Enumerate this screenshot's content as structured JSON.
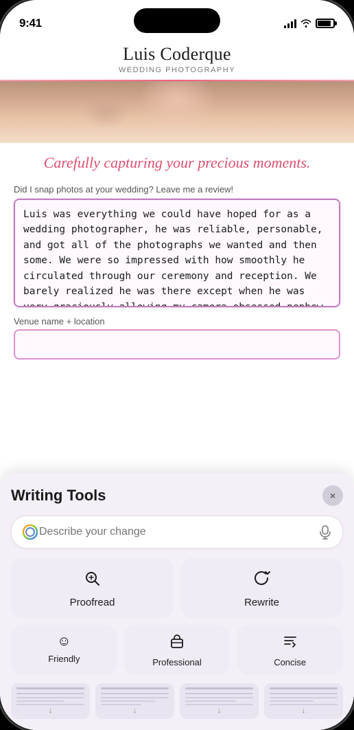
{
  "status_bar": {
    "time": "9:41"
  },
  "site_header": {
    "title": "Luis Coderque",
    "subtitle": "Wedding Photography"
  },
  "tagline": "Carefully capturing your precious moments.",
  "form": {
    "review_label": "Did I snap photos at your wedding? Leave me a review!",
    "review_text": "Luis was everything we could have hoped for as a wedding photographer, he was reliable, personable, and got all of the photographs we wanted and then some. We were so impressed with how smoothly he circulated through our ceremony and reception. We barely realized he was there except when he was very graciously allowing my camera obsessed nephew to take some photos. Thank you, Luis!",
    "venue_label": "Venue name + location",
    "venue_placeholder": ""
  },
  "writing_tools": {
    "title": "Writing Tools",
    "close_label": "×",
    "search_placeholder": "Describe your change",
    "proofread_label": "Proofread",
    "rewrite_label": "Rewrite",
    "friendly_label": "Friendly",
    "professional_label": "Professional",
    "concise_label": "Concise"
  }
}
